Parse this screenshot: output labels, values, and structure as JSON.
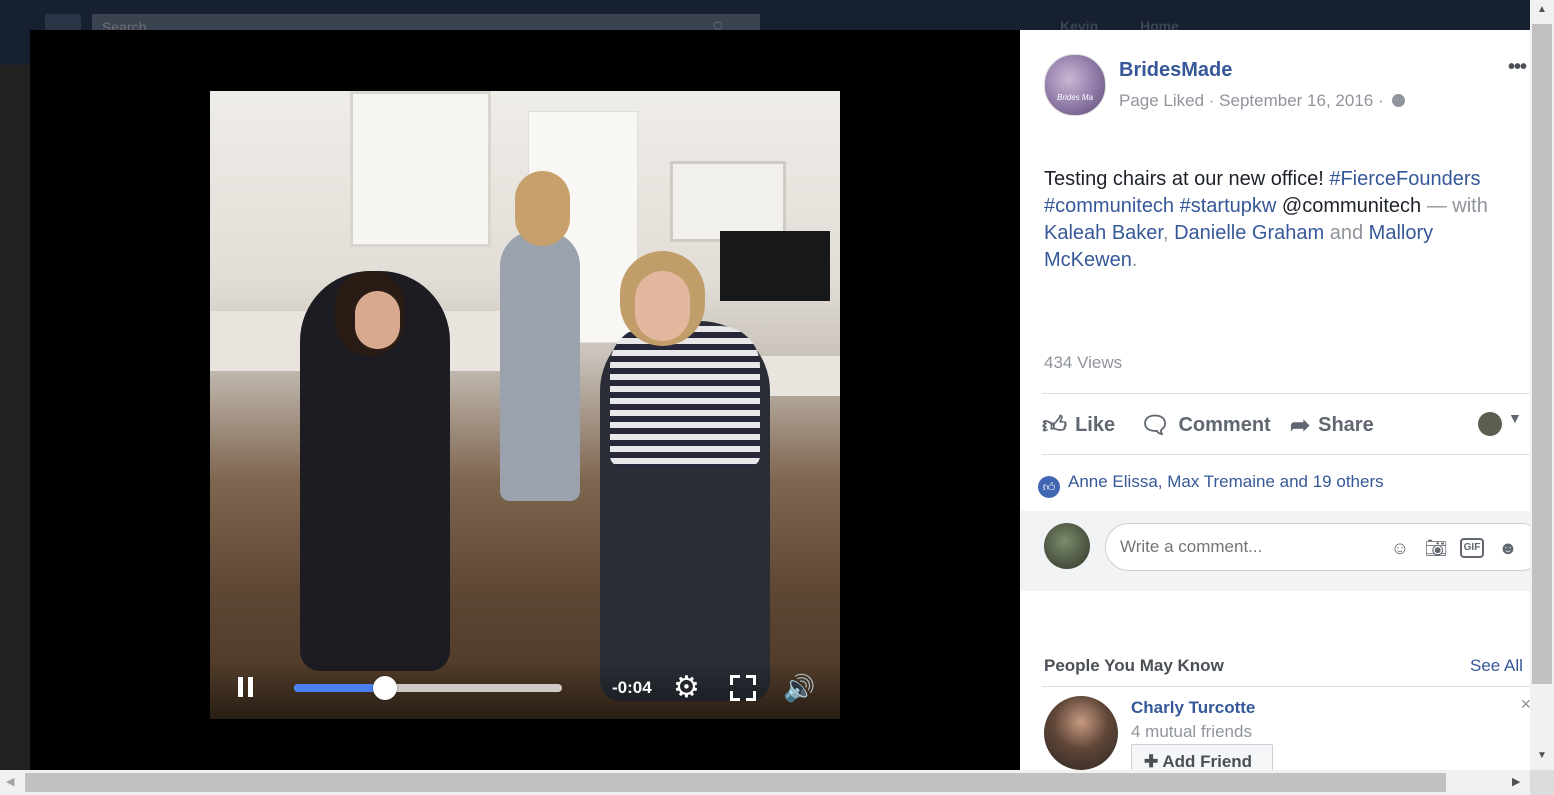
{
  "topbar": {
    "search_placeholder": "Search",
    "user_name": "Kevin",
    "home_label": "Home"
  },
  "video": {
    "time_remaining": "-0:04",
    "progress_fraction": 0.34
  },
  "post": {
    "page_name": "BridesMade",
    "meta": "Page Liked · September 16, 2016 ·",
    "text_plain": "Testing chairs at our new office! ",
    "hashtag1": "#FierceFounders",
    "hashtag2": "#communitech",
    "hashtag3": "#startupkw",
    "mention": "@communitech",
    "with_label": " — with",
    "tag1": "Kaleah Baker",
    "comma": ", ",
    "tag2": "Danielle Graham",
    "and_label": " and ",
    "tag3": "Mallory McKewen",
    "period": ".",
    "views": "434 Views"
  },
  "actions": {
    "like": "Like",
    "comment": "Comment",
    "share": "Share"
  },
  "reactions": {
    "text": "Anne Elissa, Max Tremaine and 19 others"
  },
  "comment_box": {
    "placeholder": "Write a comment...",
    "gif": "GIF"
  },
  "pymk": {
    "title": "People You May Know",
    "see_all": "See All",
    "name": "Charly Turcotte",
    "mutual": "4 mutual friends",
    "add_friend": "Add Friend"
  },
  "colors": {
    "facebook_blue": "#365899",
    "progress_blue": "#4a7ff0",
    "like_badge": "#4267b2"
  }
}
